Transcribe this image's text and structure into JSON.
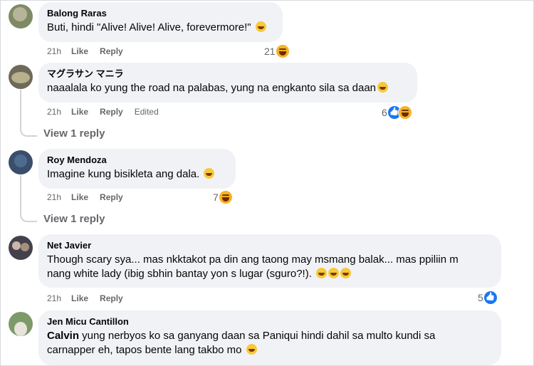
{
  "comments": [
    {
      "author": "Balong Raras",
      "text": "Buti, hindi \"Alive! Alive! Alive, forevermore!\"",
      "time": "21h",
      "like": "Like",
      "reply": "Reply",
      "reaction_count": "21",
      "reactions": [
        "haha-icon"
      ]
    },
    {
      "author": "マグラサン マニラ",
      "text": "naaalala ko yung the road na palabas, yung na engkanto sila sa daan",
      "time": "21h",
      "like": "Like",
      "reply": "Reply",
      "edited": "Edited",
      "reaction_count": "6",
      "reactions": [
        "like-icon",
        "haha-icon"
      ],
      "view_replies": "View 1 reply"
    },
    {
      "author": "Roy Mendoza",
      "text": "Imagine kung bisikleta ang dala.",
      "time": "21h",
      "like": "Like",
      "reply": "Reply",
      "reaction_count": "7",
      "reactions": [
        "haha-icon"
      ],
      "view_replies": "View 1 reply"
    },
    {
      "author": "Net Javier",
      "text_line1": "Though scary sya... mas nkktakot pa din ang taong may msmang balak... mas ppiliin m",
      "text_line2": "nang white lady (ibig sbhin bantay yon s lugar (sguro?!).",
      "time": "21h",
      "like": "Like",
      "reply": "Reply",
      "reaction_count": "5",
      "reactions": [
        "like-icon"
      ]
    },
    {
      "author": "Jen Micu Cantillon",
      "mention": "Calvin",
      "text_line1": " yung nerbyos ko sa ganyang daan sa Paniqui hindi dahil sa multo kundi sa",
      "text_line2": "carnapper eh, tapos bente lang takbo mo"
    }
  ],
  "colors": {
    "bubble": "#f0f2f5",
    "meta": "#65676b",
    "like_blue": "#1877f2",
    "haha_yellow": "#f7b125"
  }
}
